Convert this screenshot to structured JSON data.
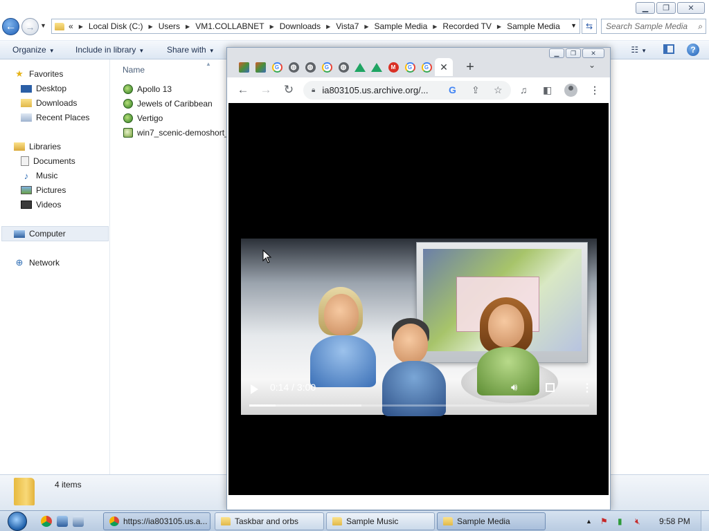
{
  "explorer": {
    "nav": {
      "back_icon": "back-arrow-icon",
      "forward_icon": "forward-arrow-icon"
    },
    "breadcrumb": {
      "overflow": "«",
      "items": [
        "Local Disk (C:)",
        "Users",
        "VM1.COLLABNET",
        "Downloads",
        "Vista7",
        "Sample Media",
        "Recorded TV",
        "Sample Media"
      ]
    },
    "search": {
      "placeholder": "Search Sample Media"
    },
    "toolbar": {
      "organize": "Organize",
      "include_in_library": "Include in library",
      "share_with": "Share with"
    },
    "nav_pane": {
      "favorites": "Favorites",
      "desktop": "Desktop",
      "downloads": "Downloads",
      "recent_places": "Recent Places",
      "libraries": "Libraries",
      "documents": "Documents",
      "music": "Music",
      "pictures": "Pictures",
      "videos": "Videos",
      "computer": "Computer",
      "network": "Network"
    },
    "content": {
      "column_name": "Name",
      "files": [
        "Apollo 13",
        "Jewels of Caribbean",
        "Vertigo",
        "win7_scenic-demoshort_"
      ]
    },
    "details": {
      "item_count": "4 items"
    }
  },
  "chrome": {
    "url": "ia803105.us.archive.org/...",
    "video": {
      "time": "0:14 / 3:00",
      "played_fraction": 0.078,
      "buffered_fraction": 0.33
    }
  },
  "taskbar": {
    "tasks": [
      {
        "label": "https://ia803105.us.a...",
        "icon": "chrome-icon"
      },
      {
        "label": "Taskbar and orbs",
        "icon": "folder-icon"
      },
      {
        "label": "Sample Music",
        "icon": "folder-icon"
      },
      {
        "label": "Sample Media",
        "icon": "folder-icon"
      }
    ],
    "clock": "9:58 PM"
  }
}
